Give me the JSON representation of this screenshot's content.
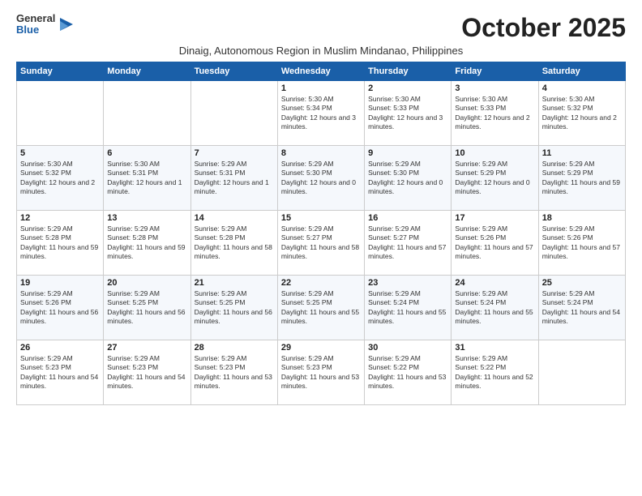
{
  "logo": {
    "general": "General",
    "blue": "Blue"
  },
  "header": {
    "month": "October 2025",
    "subtitle": "Dinaig, Autonomous Region in Muslim Mindanao, Philippines"
  },
  "weekdays": [
    "Sunday",
    "Monday",
    "Tuesday",
    "Wednesday",
    "Thursday",
    "Friday",
    "Saturday"
  ],
  "weeks": [
    [
      {
        "day": "",
        "sunrise": "",
        "sunset": "",
        "daylight": ""
      },
      {
        "day": "",
        "sunrise": "",
        "sunset": "",
        "daylight": ""
      },
      {
        "day": "",
        "sunrise": "",
        "sunset": "",
        "daylight": ""
      },
      {
        "day": "1",
        "sunrise": "Sunrise: 5:30 AM",
        "sunset": "Sunset: 5:34 PM",
        "daylight": "Daylight: 12 hours and 3 minutes."
      },
      {
        "day": "2",
        "sunrise": "Sunrise: 5:30 AM",
        "sunset": "Sunset: 5:33 PM",
        "daylight": "Daylight: 12 hours and 3 minutes."
      },
      {
        "day": "3",
        "sunrise": "Sunrise: 5:30 AM",
        "sunset": "Sunset: 5:33 PM",
        "daylight": "Daylight: 12 hours and 2 minutes."
      },
      {
        "day": "4",
        "sunrise": "Sunrise: 5:30 AM",
        "sunset": "Sunset: 5:32 PM",
        "daylight": "Daylight: 12 hours and 2 minutes."
      }
    ],
    [
      {
        "day": "5",
        "sunrise": "Sunrise: 5:30 AM",
        "sunset": "Sunset: 5:32 PM",
        "daylight": "Daylight: 12 hours and 2 minutes."
      },
      {
        "day": "6",
        "sunrise": "Sunrise: 5:30 AM",
        "sunset": "Sunset: 5:31 PM",
        "daylight": "Daylight: 12 hours and 1 minute."
      },
      {
        "day": "7",
        "sunrise": "Sunrise: 5:29 AM",
        "sunset": "Sunset: 5:31 PM",
        "daylight": "Daylight: 12 hours and 1 minute."
      },
      {
        "day": "8",
        "sunrise": "Sunrise: 5:29 AM",
        "sunset": "Sunset: 5:30 PM",
        "daylight": "Daylight: 12 hours and 0 minutes."
      },
      {
        "day": "9",
        "sunrise": "Sunrise: 5:29 AM",
        "sunset": "Sunset: 5:30 PM",
        "daylight": "Daylight: 12 hours and 0 minutes."
      },
      {
        "day": "10",
        "sunrise": "Sunrise: 5:29 AM",
        "sunset": "Sunset: 5:29 PM",
        "daylight": "Daylight: 12 hours and 0 minutes."
      },
      {
        "day": "11",
        "sunrise": "Sunrise: 5:29 AM",
        "sunset": "Sunset: 5:29 PM",
        "daylight": "Daylight: 11 hours and 59 minutes."
      }
    ],
    [
      {
        "day": "12",
        "sunrise": "Sunrise: 5:29 AM",
        "sunset": "Sunset: 5:28 PM",
        "daylight": "Daylight: 11 hours and 59 minutes."
      },
      {
        "day": "13",
        "sunrise": "Sunrise: 5:29 AM",
        "sunset": "Sunset: 5:28 PM",
        "daylight": "Daylight: 11 hours and 59 minutes."
      },
      {
        "day": "14",
        "sunrise": "Sunrise: 5:29 AM",
        "sunset": "Sunset: 5:28 PM",
        "daylight": "Daylight: 11 hours and 58 minutes."
      },
      {
        "day": "15",
        "sunrise": "Sunrise: 5:29 AM",
        "sunset": "Sunset: 5:27 PM",
        "daylight": "Daylight: 11 hours and 58 minutes."
      },
      {
        "day": "16",
        "sunrise": "Sunrise: 5:29 AM",
        "sunset": "Sunset: 5:27 PM",
        "daylight": "Daylight: 11 hours and 57 minutes."
      },
      {
        "day": "17",
        "sunrise": "Sunrise: 5:29 AM",
        "sunset": "Sunset: 5:26 PM",
        "daylight": "Daylight: 11 hours and 57 minutes."
      },
      {
        "day": "18",
        "sunrise": "Sunrise: 5:29 AM",
        "sunset": "Sunset: 5:26 PM",
        "daylight": "Daylight: 11 hours and 57 minutes."
      }
    ],
    [
      {
        "day": "19",
        "sunrise": "Sunrise: 5:29 AM",
        "sunset": "Sunset: 5:26 PM",
        "daylight": "Daylight: 11 hours and 56 minutes."
      },
      {
        "day": "20",
        "sunrise": "Sunrise: 5:29 AM",
        "sunset": "Sunset: 5:25 PM",
        "daylight": "Daylight: 11 hours and 56 minutes."
      },
      {
        "day": "21",
        "sunrise": "Sunrise: 5:29 AM",
        "sunset": "Sunset: 5:25 PM",
        "daylight": "Daylight: 11 hours and 56 minutes."
      },
      {
        "day": "22",
        "sunrise": "Sunrise: 5:29 AM",
        "sunset": "Sunset: 5:25 PM",
        "daylight": "Daylight: 11 hours and 55 minutes."
      },
      {
        "day": "23",
        "sunrise": "Sunrise: 5:29 AM",
        "sunset": "Sunset: 5:24 PM",
        "daylight": "Daylight: 11 hours and 55 minutes."
      },
      {
        "day": "24",
        "sunrise": "Sunrise: 5:29 AM",
        "sunset": "Sunset: 5:24 PM",
        "daylight": "Daylight: 11 hours and 55 minutes."
      },
      {
        "day": "25",
        "sunrise": "Sunrise: 5:29 AM",
        "sunset": "Sunset: 5:24 PM",
        "daylight": "Daylight: 11 hours and 54 minutes."
      }
    ],
    [
      {
        "day": "26",
        "sunrise": "Sunrise: 5:29 AM",
        "sunset": "Sunset: 5:23 PM",
        "daylight": "Daylight: 11 hours and 54 minutes."
      },
      {
        "day": "27",
        "sunrise": "Sunrise: 5:29 AM",
        "sunset": "Sunset: 5:23 PM",
        "daylight": "Daylight: 11 hours and 54 minutes."
      },
      {
        "day": "28",
        "sunrise": "Sunrise: 5:29 AM",
        "sunset": "Sunset: 5:23 PM",
        "daylight": "Daylight: 11 hours and 53 minutes."
      },
      {
        "day": "29",
        "sunrise": "Sunrise: 5:29 AM",
        "sunset": "Sunset: 5:23 PM",
        "daylight": "Daylight: 11 hours and 53 minutes."
      },
      {
        "day": "30",
        "sunrise": "Sunrise: 5:29 AM",
        "sunset": "Sunset: 5:22 PM",
        "daylight": "Daylight: 11 hours and 53 minutes."
      },
      {
        "day": "31",
        "sunrise": "Sunrise: 5:29 AM",
        "sunset": "Sunset: 5:22 PM",
        "daylight": "Daylight: 11 hours and 52 minutes."
      },
      {
        "day": "",
        "sunrise": "",
        "sunset": "",
        "daylight": ""
      }
    ]
  ]
}
